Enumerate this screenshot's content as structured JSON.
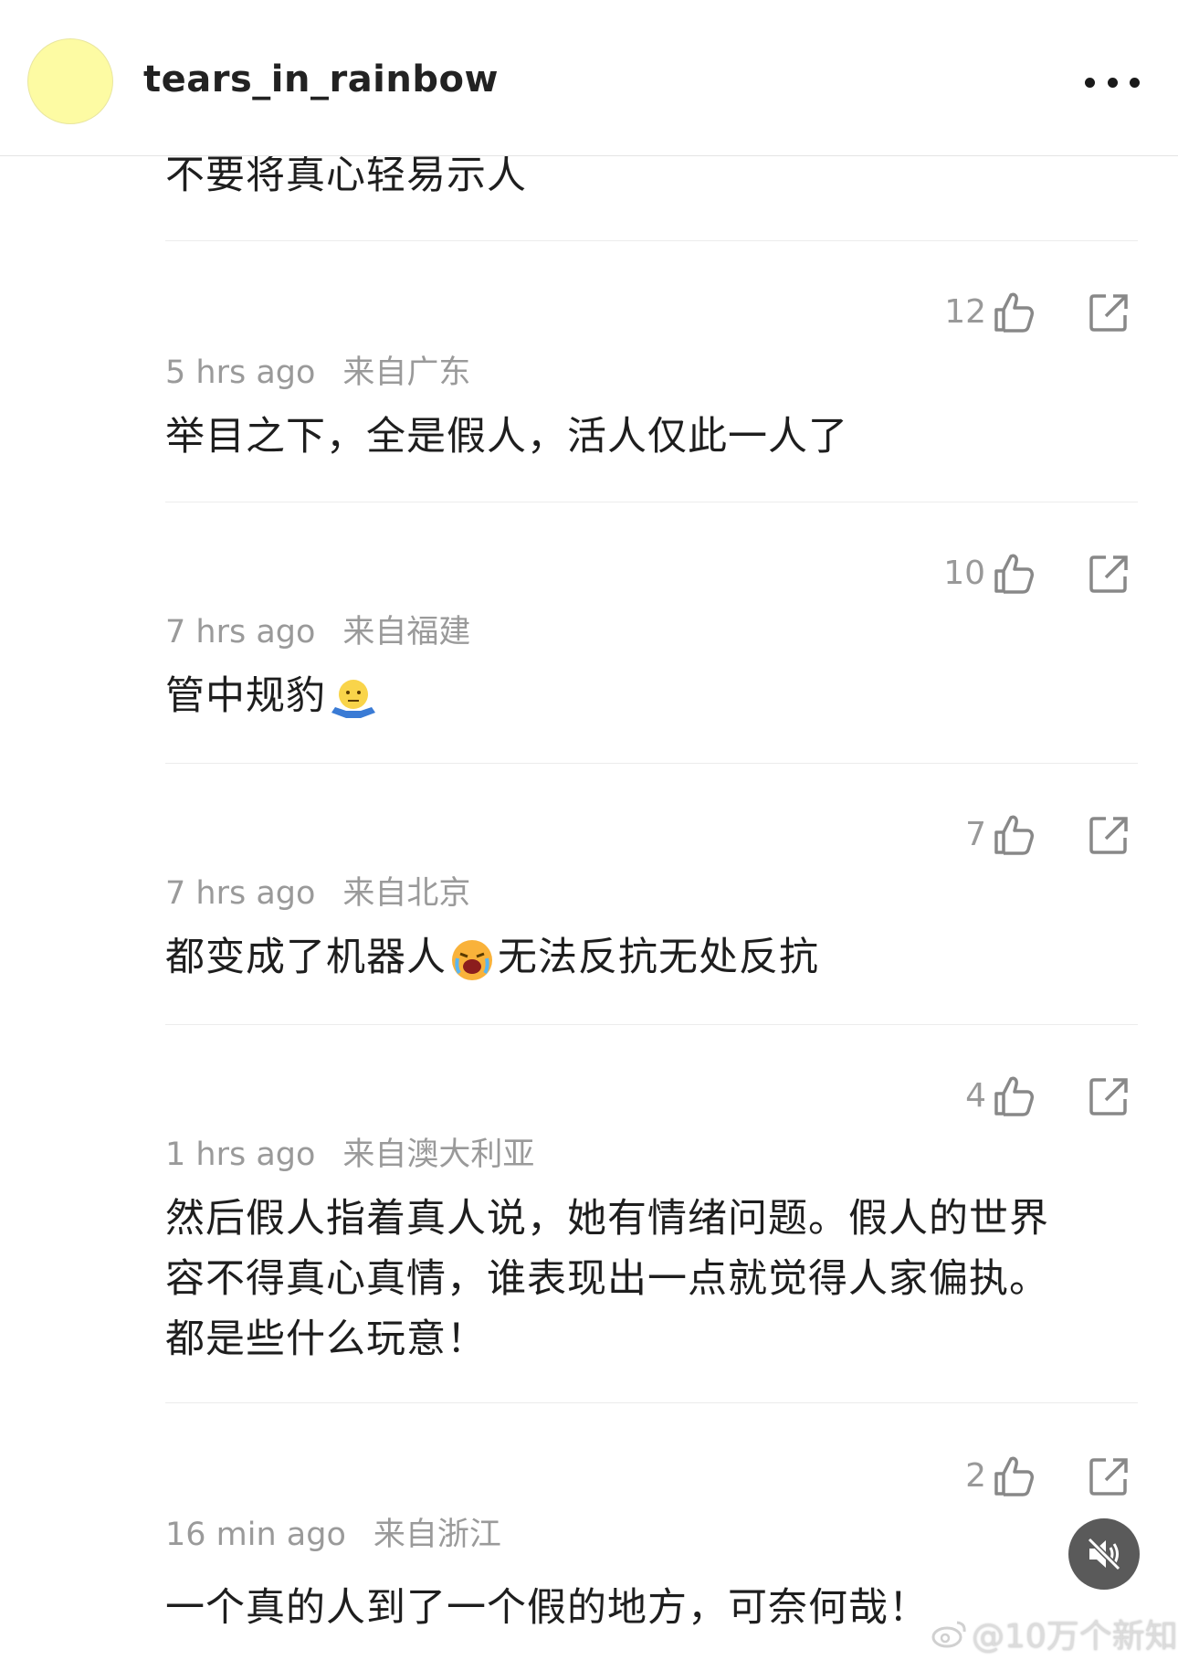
{
  "header": {
    "username": "tears_in_rainbow",
    "avatar_color": "#fdfba3"
  },
  "comments_top": {
    "partial_text": "不要将真心轻易示人"
  },
  "comments": [
    {
      "likes": "12",
      "time": "5 hrs ago",
      "location": "来自广东",
      "text": "举目之下，全是假人，活人仅此一人了"
    },
    {
      "likes": "10",
      "time": "7 hrs ago",
      "location": "来自福建",
      "text": "管中规豹",
      "emoji": "shrug-emoji"
    },
    {
      "likes": "7",
      "time": "7 hrs ago",
      "location": "来自北京",
      "text_before": "都变成了机器人",
      "text_after": "无法反抗无处反抗",
      "emoji": "crying-emoji"
    },
    {
      "likes": "4",
      "time": "1 hrs ago",
      "location": "来自澳大利亚",
      "lines": [
        "然后假人指着真人说，她有情绪问题。假人的世界",
        "容不得真心真情，谁表现出一点就觉得人家偏执。",
        "都是些什么玩意！"
      ]
    },
    {
      "likes": "2",
      "time": "16 min ago",
      "location": "来自浙江",
      "text": "一个真的人到了一个假的地方，可奈何哉！"
    }
  ],
  "watermark": {
    "text": "@10万个新知"
  }
}
